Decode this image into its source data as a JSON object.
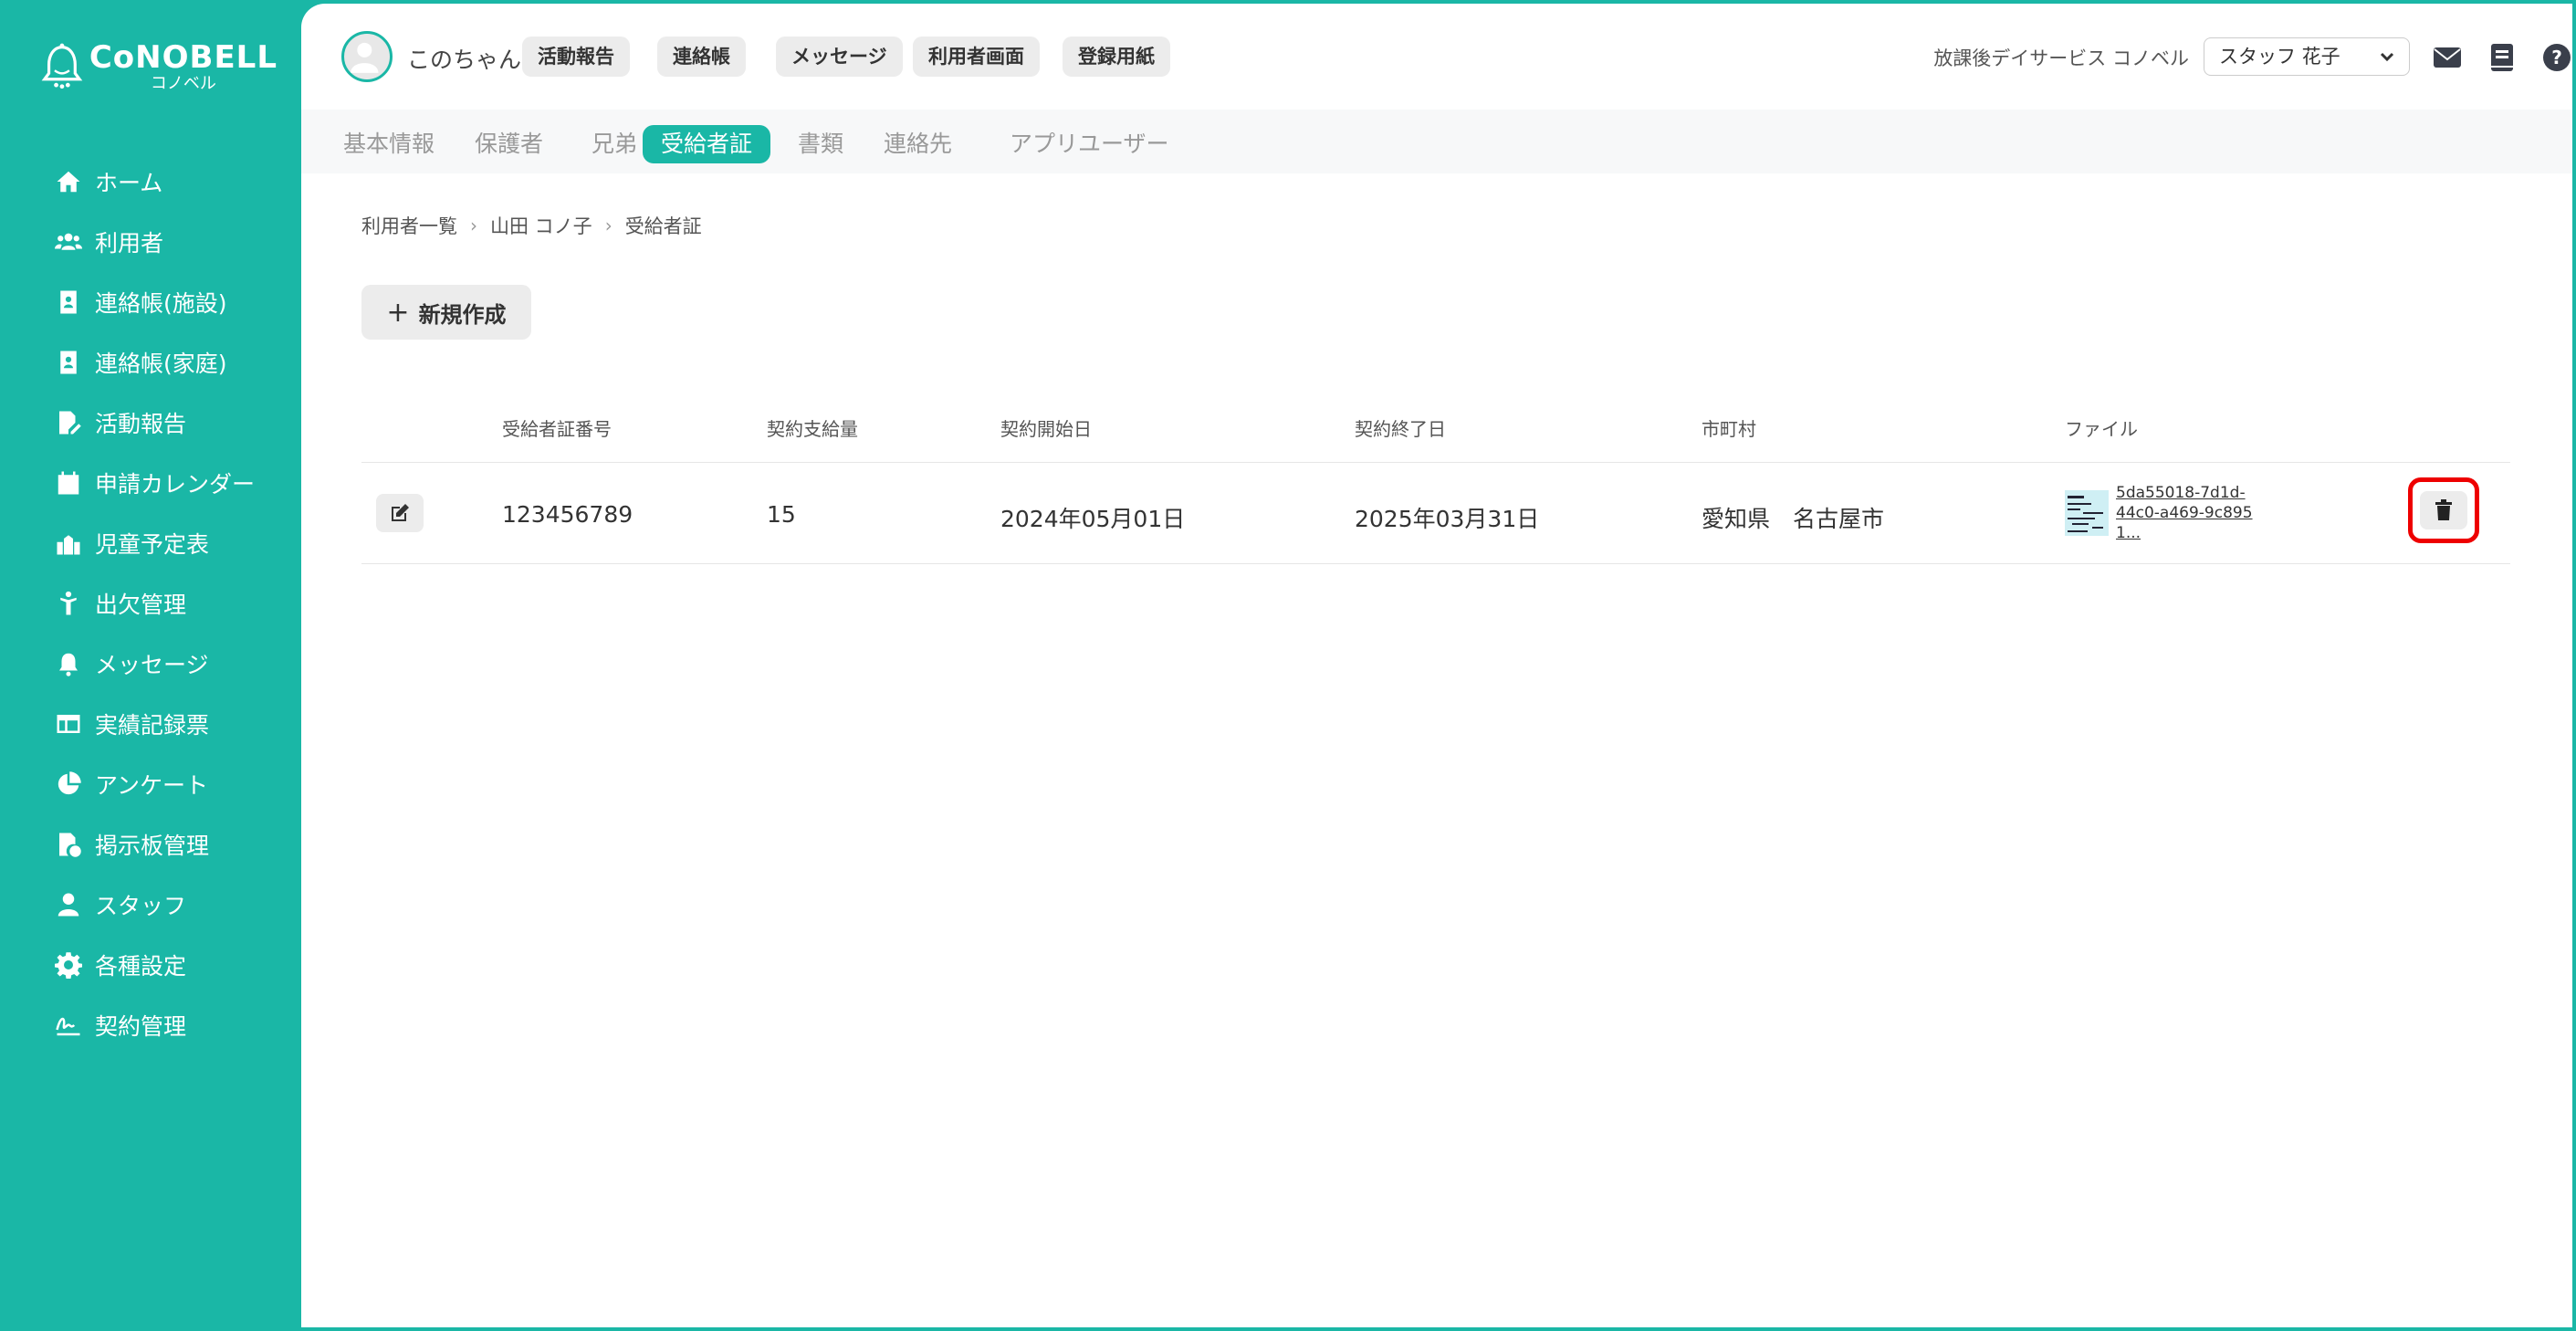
{
  "brand": {
    "name": "CoNOBELL",
    "sub": "コノベル"
  },
  "colors": {
    "accent": "#1ab7a6",
    "highlight": "#e00000"
  },
  "sidebar": {
    "items": [
      {
        "label": "ホーム",
        "icon": "home-icon"
      },
      {
        "label": "利用者",
        "icon": "users-icon"
      },
      {
        "label": "連絡帳(施設)",
        "icon": "contact-book-icon"
      },
      {
        "label": "連絡帳(家庭)",
        "icon": "contact-book-icon"
      },
      {
        "label": "活動報告",
        "icon": "file-edit-icon"
      },
      {
        "label": "申請カレンダー",
        "icon": "calendar-icon"
      },
      {
        "label": "児童予定表",
        "icon": "school-icon"
      },
      {
        "label": "出欠管理",
        "icon": "child-icon"
      },
      {
        "label": "メッセージ",
        "icon": "bell-icon"
      },
      {
        "label": "実績記録票",
        "icon": "table-icon"
      },
      {
        "label": "アンケート",
        "icon": "pie-chart-icon"
      },
      {
        "label": "掲示板管理",
        "icon": "file-check-icon"
      },
      {
        "label": "スタッフ",
        "icon": "staff-icon"
      },
      {
        "label": "各種設定",
        "icon": "gear-icon"
      },
      {
        "label": "契約管理",
        "icon": "signature-icon"
      }
    ]
  },
  "header": {
    "user_name": "このちゃん",
    "chips": [
      "活動報告",
      "連絡帳",
      "メッセージ",
      "利用者画面",
      "登録用紙"
    ],
    "facility": "放課後デイサービス コノベル",
    "staff_selected": "スタッフ 花子"
  },
  "tabs": [
    {
      "label": "基本情報",
      "active": false
    },
    {
      "label": "保護者",
      "active": false
    },
    {
      "label": "兄弟",
      "active": false
    },
    {
      "label": "受給者証",
      "active": true
    },
    {
      "label": "書類",
      "active": false
    },
    {
      "label": "連絡先",
      "active": false
    },
    {
      "label": "アプリユーザー",
      "active": false
    }
  ],
  "breadcrumb": [
    "利用者一覧",
    "山田 コノ子",
    "受給者証"
  ],
  "new_button_label": "新規作成",
  "table": {
    "headers": [
      "受給者証番号",
      "契約支給量",
      "契約開始日",
      "契約終了日",
      "市町村",
      "ファイル"
    ],
    "rows": [
      {
        "number": "123456789",
        "amount": "15",
        "start": "2024年05月01日",
        "end": "2025年03月31日",
        "city": "愛知県　名古屋市",
        "file": "5da55018-7d1d-44c0-a469-9c8951..."
      }
    ]
  }
}
